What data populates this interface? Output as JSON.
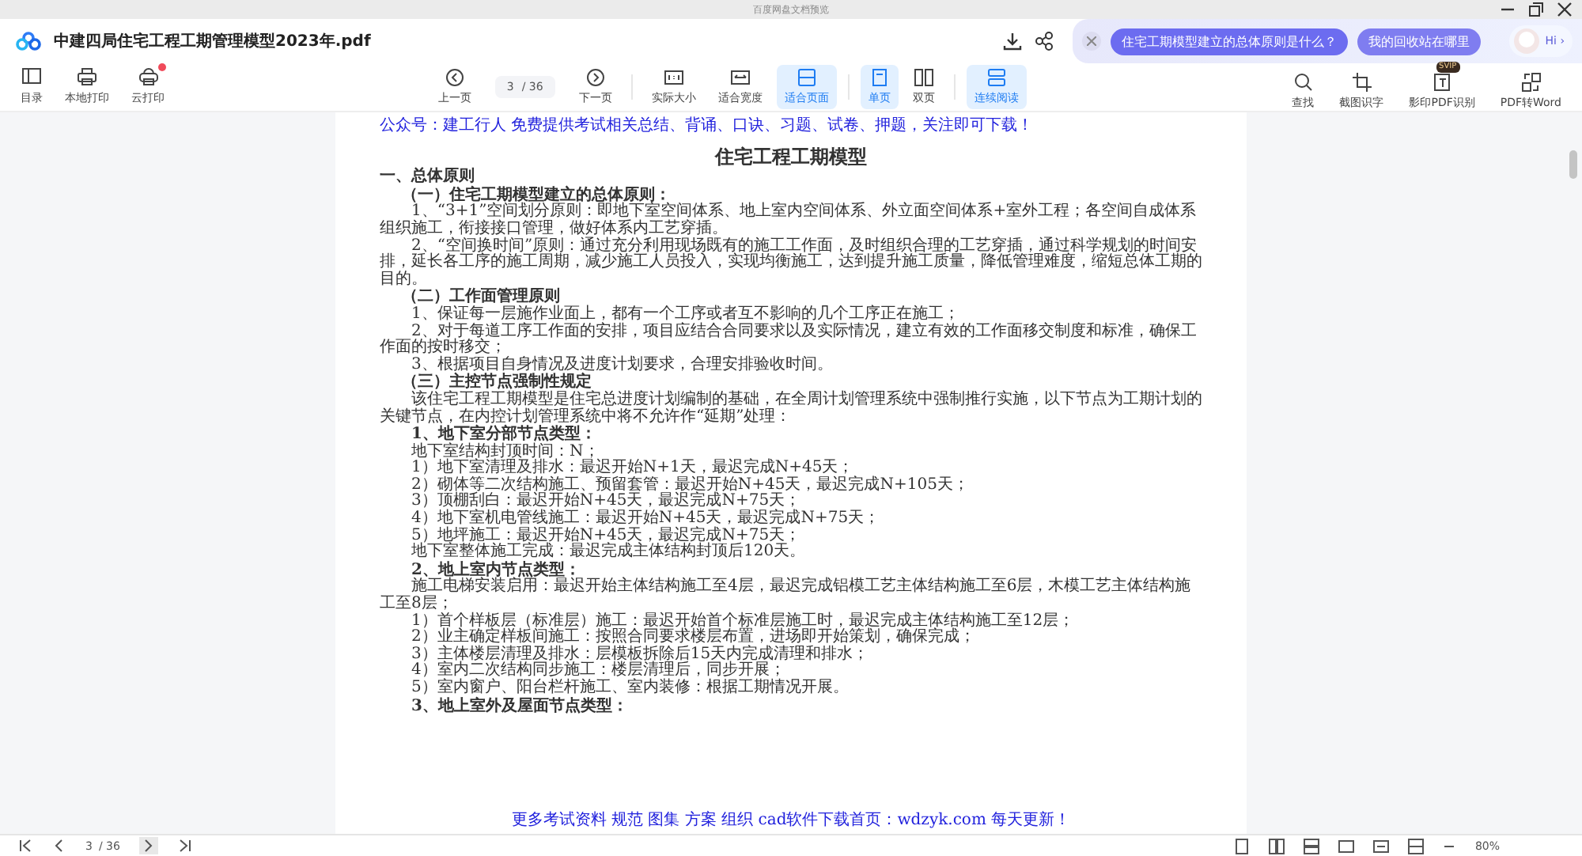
{
  "window": {
    "title": "百度网盘文档预览"
  },
  "header": {
    "filename": "中建四局住宅工程工期管理模型2023年.pdf"
  },
  "assistant": {
    "suggestions": [
      "住宅工期模型建立的总体原则是什么？",
      "我的回收站在哪里"
    ],
    "greeting": "Hi ›"
  },
  "toolbar": {
    "left": [
      {
        "label": "目录",
        "badge": false
      },
      {
        "label": "本地打印",
        "badge": false
      },
      {
        "label": "云打印",
        "badge": true
      }
    ],
    "prev": "上一页",
    "page_field": {
      "value": "3",
      "total": "/ 36"
    },
    "next": "下一页",
    "views": [
      {
        "label": "实际大小",
        "selected": false
      },
      {
        "label": "适合宽度",
        "selected": false
      },
      {
        "label": "适合页面",
        "selected": true
      },
      {
        "label": "单页",
        "selected": true
      },
      {
        "label": "双页",
        "selected": false
      },
      {
        "label": "连续阅读",
        "selected": true
      }
    ],
    "right": [
      {
        "label": "查找"
      },
      {
        "label": "截图识字"
      },
      {
        "label": "影印PDF识别",
        "tag": "SVIP"
      },
      {
        "label": "PDF转Word"
      }
    ]
  },
  "document": [
    {
      "kind": "notice",
      "text": "公众号：建工行人 免费提供考试相关总结、背诵、口诀、习题、试卷、押题，关注即可下载！"
    },
    {
      "kind": "title",
      "text": "住宅工程工期模型"
    },
    {
      "kind": "h1",
      "text": "一、总体原则"
    },
    {
      "kind": "h2",
      "text": "（一）住宅工期模型建立的总体原则："
    },
    {
      "kind": "p",
      "text": "1、“3+1”空间划分原则：即地下室空间体系、地上室内空间体系、外立面空间体系+室外工程；各空间自成体系组织施工，衔接接口管理，做好体系内工艺穿插。"
    },
    {
      "kind": "p",
      "text": "2、“空间换时间”原则：通过充分利用现场既有的施工工作面，及时组织合理的工艺穿插，通过科学规划的时间安排，延长各工序的施工周期，减少施工人员投入，实现均衡施工，达到提升施工质量，降低管理难度，缩短总体工期的目的。"
    },
    {
      "kind": "h2",
      "text": "（二）工作面管理原则"
    },
    {
      "kind": "p",
      "text": "1、保证每一层施作业面上，都有一个工序或者互不影响的几个工序正在施工；"
    },
    {
      "kind": "p",
      "text": "2、对于每道工序工作面的安排，项目应结合合同要求以及实际情况，建立有效的工作面移交制度和标准，确保工作面的按时移交；"
    },
    {
      "kind": "p",
      "text": "3、根据项目自身情况及进度计划要求，合理安排验收时间。"
    },
    {
      "kind": "h2",
      "text": "（三）主控节点强制性规定"
    },
    {
      "kind": "p",
      "text": "该住宅工程工期模型是住宅总进度计划编制的基础，在全周计划管理系统中强制推行实施，以下节点为工期计划的关键节点，在内控计划管理系统中将不允许作“延期”处理："
    },
    {
      "kind": "h3",
      "text": "1、地下室分部节点类型："
    },
    {
      "kind": "p",
      "text": "地下室结构封顶时间：N；"
    },
    {
      "kind": "p",
      "text": "1）地下室清理及排水：最迟开始N+1天，最迟完成N+45天；"
    },
    {
      "kind": "p",
      "text": "2）砌体等二次结构施工、预留套管：最迟开始N+45天，最迟完成N+105天；"
    },
    {
      "kind": "p",
      "text": "3）顶棚刮白：最迟开始N+45天，最迟完成N+75天；"
    },
    {
      "kind": "p",
      "text": "4）地下室机电管线施工：最迟开始N+45天，最迟完成N+75天；"
    },
    {
      "kind": "p",
      "text": "5）地坪施工：最迟开始N+45天，最迟完成N+75天；"
    },
    {
      "kind": "p",
      "text": "地下室整体施工完成：最迟完成主体结构封顶后120天。"
    },
    {
      "kind": "h3",
      "text": "2、地上室内节点类型："
    },
    {
      "kind": "p",
      "text": "施工电梯安装启用：最迟开始主体结构施工至4层，最迟完成铝模工艺主体结构施工至6层，木模工艺主体结构施工至8层；"
    },
    {
      "kind": "p",
      "text": "1）首个样板层（标准层）施工：最迟开始首个标准层施工时，最迟完成主体结构施工至12层；"
    },
    {
      "kind": "p",
      "text": "2）业主确定样板间施工：按照合同要求楼层布置，进场即开始策划，确保完成；"
    },
    {
      "kind": "p",
      "text": "3）主体楼层清理及排水：层模板拆除后15天内完成清理和排水；"
    },
    {
      "kind": "p",
      "text": "4）室内二次结构同步施工：楼层清理后，同步开展；"
    },
    {
      "kind": "p",
      "text": "5）室内窗户、阳台栏杆施工、室内装修：根据工期情况开展。"
    },
    {
      "kind": "h3",
      "text": "3、地上室外及屋面节点类型："
    },
    {
      "kind": "footer",
      "text": "更多考试资料 规范 图集 方案 组织 cad软件下载首页：wdzyk.com 每天更新！"
    }
  ],
  "bottom_bar": {
    "page_field": {
      "value": "3",
      "total": "/ 36"
    },
    "zoom": "80%"
  }
}
